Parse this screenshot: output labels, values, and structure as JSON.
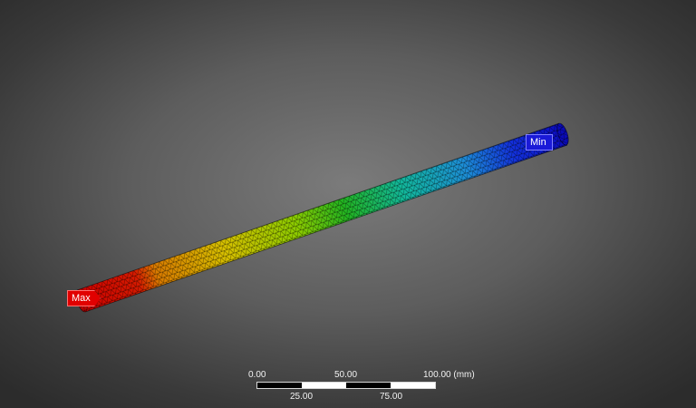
{
  "result_view": {
    "max_probe_label": "Max",
    "min_probe_label": "Min",
    "contour_colors": [
      "#d40000",
      "#e06a00",
      "#d9c400",
      "#8fcf00",
      "#1fb71a",
      "#10b79a",
      "#1e8fd8",
      "#1233e0",
      "#0c0cc8"
    ]
  },
  "scale_ruler": {
    "top_labels": [
      "0.00",
      "50.00",
      "100.00 (mm)"
    ],
    "bottom_labels": [
      "25.00",
      "75.00"
    ]
  }
}
